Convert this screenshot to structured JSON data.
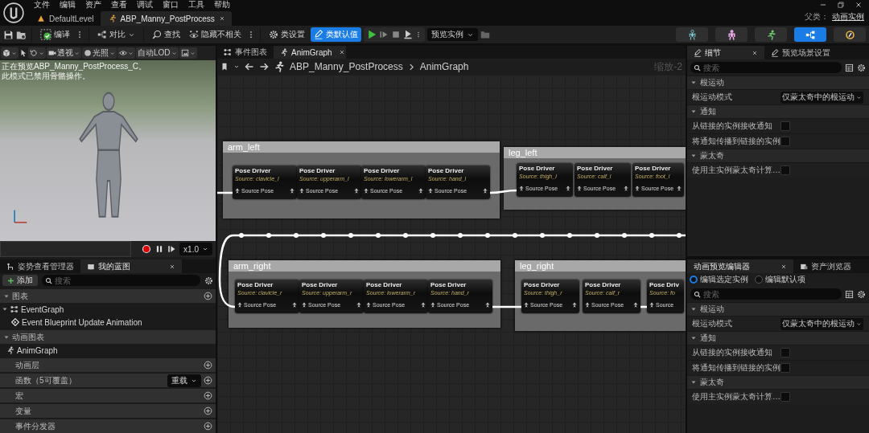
{
  "menu": [
    "文件",
    "编辑",
    "资产",
    "查看",
    "调试",
    "窗口",
    "工具",
    "帮助"
  ],
  "document_tabs": [
    {
      "kind": "level",
      "label": "DefaultLevel",
      "selected": false
    },
    {
      "kind": "anim-blueprint",
      "label": "ABP_Manny_PostProcess",
      "selected": true
    }
  ],
  "parent_class": {
    "label": "父类：",
    "value": "动画实例"
  },
  "toolbar": {
    "compile": "编译",
    "diff": "对比",
    "find": "查找",
    "hide_unrelated": "隐藏不相关",
    "class_settings": {
      "label": "类设置",
      "selected": false
    },
    "class_defaults": {
      "label": "类默认值",
      "selected": true
    },
    "preview": "预览实例"
  },
  "modes": [
    {
      "kind": "skeleton",
      "selected": false
    },
    {
      "kind": "mesh",
      "selected": false
    },
    {
      "kind": "animation",
      "selected": false
    },
    {
      "kind": "blueprint",
      "selected": true
    },
    {
      "kind": "physics",
      "selected": false
    }
  ],
  "viewport": {
    "view": "透视",
    "lighting": "光照",
    "lod": "自动LOD",
    "messages": [
      "正在预览ABP_Manny_PostProcess_C。",
      "此模式已禁用骨骼操作。"
    ],
    "speed": "x1.0"
  },
  "left_panel": {
    "tabs": [
      {
        "label": "姿势查看管理器",
        "selected": false
      },
      {
        "label": "我的蓝图",
        "selected": true
      }
    ],
    "add": "添加",
    "search_placeholder": "搜索",
    "sections": [
      {
        "title": "图表",
        "expanded": true,
        "addable": true,
        "children": [
          {
            "kind": "graph",
            "label": "EventGraph",
            "children": [
              {
                "kind": "event",
                "label": "Event Blueprint Update Animation"
              }
            ]
          }
        ]
      },
      {
        "title": "动画图表",
        "expanded": true,
        "addable": false,
        "children": [
          {
            "kind": "anim-graph",
            "label": "AnimGraph"
          }
        ]
      },
      {
        "title": "动画层",
        "expanded": false,
        "addable": true
      },
      {
        "title": "函数（5可覆盖）",
        "expanded": false,
        "addable": true,
        "override": "重载"
      },
      {
        "title": "宏",
        "expanded": false,
        "addable": true
      },
      {
        "title": "变量",
        "expanded": false,
        "addable": true
      },
      {
        "title": "事件分发器",
        "expanded": false,
        "addable": true
      }
    ]
  },
  "graph": {
    "tabs": [
      {
        "kind": "event-graph",
        "label": "事件图表",
        "selected": false
      },
      {
        "kind": "anim-graph",
        "label": "AnimGraph",
        "selected": true
      }
    ],
    "breadcrumb": [
      "ABP_Manny_PostProcess",
      "AnimGraph"
    ],
    "zoom": "缩放-2",
    "comments": [
      {
        "title": "arm_left",
        "nodes": [
          {
            "title": "Pose Driver",
            "source": "Source: clavicle_l",
            "pin": "Source Pose"
          },
          {
            "title": "Pose Driver",
            "source": "Source: upperarm_l",
            "pin": "Source Pose"
          },
          {
            "title": "Pose Driver",
            "source": "Source: lowerarm_l",
            "pin": "Source Pose"
          },
          {
            "title": "Pose Driver",
            "source": "Source: hand_l",
            "pin": "Source Pose"
          }
        ]
      },
      {
        "title": "leg_left",
        "nodes": [
          {
            "title": "Pose Driver",
            "source": "Source: thigh_l",
            "pin": "Source Pose"
          },
          {
            "title": "Pose Driver",
            "source": "Source: calf_l",
            "pin": "Source Pose"
          },
          {
            "title": "Pose Driver",
            "source": "Source: foot_l",
            "pin": "Source Pose"
          }
        ]
      },
      {
        "title": "arm_right",
        "nodes": [
          {
            "title": "Pose Driver",
            "source": "Source: clavicle_r",
            "pin": "Source Pose"
          },
          {
            "title": "Pose Driver",
            "source": "Source: upperarm_r",
            "pin": "Source Pose"
          },
          {
            "title": "Pose Driver",
            "source": "Source: lowerarm_r",
            "pin": "Source Pose"
          },
          {
            "title": "Pose Driver",
            "source": "Source: hand_r",
            "pin": "Source Pose"
          }
        ]
      },
      {
        "title": "leg_right",
        "nodes": [
          {
            "title": "Pose Driver",
            "source": "Source: thigh_r",
            "pin": "Source Pose"
          },
          {
            "title": "Pose Driver",
            "source": "Source: calf_r",
            "pin": "Source Pose"
          },
          {
            "title": "Pose Driv",
            "source": "Source: fo",
            "pin": "Source"
          }
        ]
      }
    ]
  },
  "details": {
    "tabs": [
      {
        "label": "细节",
        "selected": true
      },
      {
        "label": "预览场景设置",
        "selected": false
      }
    ],
    "search_placeholder": "搜索",
    "categories": [
      {
        "title": "根运动",
        "expanded": true,
        "properties": [
          {
            "kind": "dropdown",
            "label": "根运动模式",
            "value": "仅蒙太奇中的根运动"
          }
        ]
      },
      {
        "title": "通知",
        "expanded": true,
        "properties": [
          {
            "kind": "checkbox",
            "label": "从链接的实例接收通知",
            "checked": false
          },
          {
            "kind": "checkbox",
            "label": "将通知传播到链接的实例",
            "checked": false
          }
        ]
      },
      {
        "title": "蒙太奇",
        "expanded": true,
        "properties": [
          {
            "kind": "checkbox",
            "label": "使用主实例蒙太奇计算…",
            "checked": false
          }
        ]
      }
    ]
  },
  "preview_editor": {
    "tabs": [
      {
        "label": "动画预览编辑器",
        "selected": true
      },
      {
        "label": "资产浏览器",
        "selected": false
      }
    ],
    "modes": [
      {
        "label": "编辑选定实例",
        "selected": true
      },
      {
        "label": "编辑默认项",
        "selected": false
      }
    ],
    "search_placeholder": "搜索",
    "categories": [
      {
        "title": "根运动",
        "expanded": true,
        "properties": [
          {
            "kind": "dropdown",
            "label": "根运动模式",
            "value": "仅蒙太奇中的根运动"
          }
        ]
      },
      {
        "title": "通知",
        "expanded": true,
        "properties": [
          {
            "kind": "checkbox",
            "label": "从链接的实例接收通知",
            "checked": false
          },
          {
            "kind": "checkbox",
            "label": "将通知传播到链接的实例",
            "checked": false
          }
        ]
      },
      {
        "title": "蒙太奇",
        "expanded": true,
        "properties": [
          {
            "kind": "checkbox",
            "label": "使用主实例蒙太奇计算…",
            "checked": false
          }
        ]
      }
    ]
  }
}
